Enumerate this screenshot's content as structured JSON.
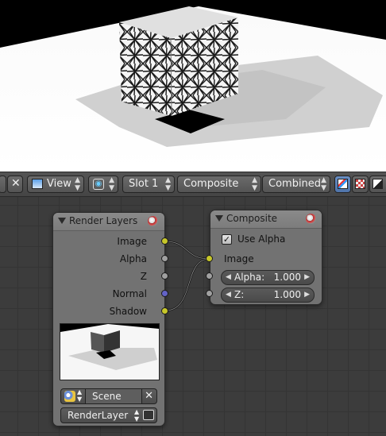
{
  "header": {
    "view_menu_label": "View",
    "slot_label": "Slot 1",
    "composite_label": "Composite",
    "pass_label": "Combined",
    "icons": [
      "image-editor-icon",
      "close-icon",
      "pin-icon",
      "color-alpha-icon",
      "alpha-icon",
      "z-buffer-icon"
    ]
  },
  "nodes": {
    "render_layers": {
      "title": "Render Layers",
      "outputs": [
        {
          "label": "Image",
          "color": "#c7c729"
        },
        {
          "label": "Alpha",
          "color": "#a0a0a0"
        },
        {
          "label": "Z",
          "color": "#a0a0a0"
        },
        {
          "label": "Normal",
          "color": "#6363c7"
        },
        {
          "label": "Shadow",
          "color": "#c7c729"
        }
      ],
      "scene_label": "Scene",
      "layer_label": "RenderLayer"
    },
    "composite": {
      "title": "Composite",
      "use_alpha_label": "Use Alpha",
      "use_alpha_checked": true,
      "image_label": "Image",
      "alpha_label": "Alpha:",
      "alpha_value": "1.000",
      "z_label": "Z:",
      "z_value": "1.000"
    }
  },
  "colors": {
    "socket_yellow": "#c7c729",
    "socket_gray": "#a0a0a0",
    "socket_blue": "#6363c7",
    "node_body": "#727272",
    "editor_bg": "#3c3c3c"
  }
}
